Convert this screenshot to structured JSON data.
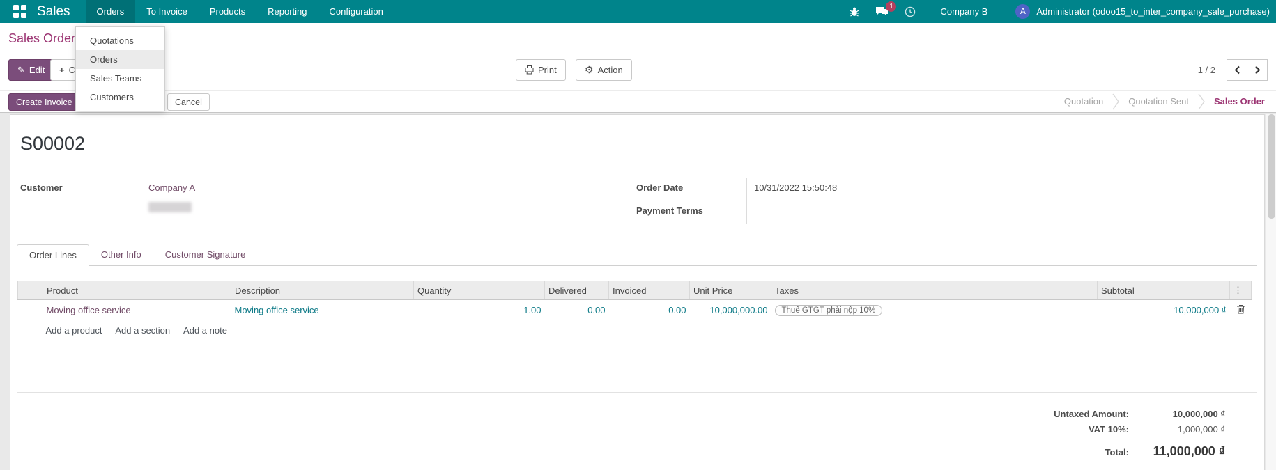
{
  "colors": {
    "topbar_teal": "#00848b",
    "brand_purple": "#7b4d7b",
    "link_purple": "#714b67",
    "active_magenta": "#9c3573",
    "value_teal": "#0d7a87",
    "badge_red": "#b33f5e",
    "avatar_blue": "#4f63c6"
  },
  "icons": {
    "apps_grid": "grid-of-squares",
    "edit_pencil": "✎",
    "create_plus": "+",
    "printer": "printer-glyph",
    "action_gear": "⚙",
    "bug": "bug-glyph",
    "messages": "chat-bubbles",
    "activities": "clock-glyph",
    "pager_prev": "chevron-left",
    "pager_next": "chevron-right",
    "delete_row": "trash-can",
    "optional_columns": "⋮"
  },
  "topbar": {
    "app_name": "Sales",
    "menu": [
      "Orders",
      "To Invoice",
      "Products",
      "Reporting",
      "Configuration"
    ],
    "active_menu": "Orders",
    "message_count": "1",
    "company": "Company B",
    "avatar_initial": "A",
    "user": "Administrator (odoo15_to_inter_company_sale_purchase)"
  },
  "breadcrumb": {
    "title": "Sales Orders"
  },
  "control_panel": {
    "edit": "Edit",
    "create": "Create",
    "print": "Print",
    "action": "Action",
    "pager": "1 / 2"
  },
  "orders_menu": {
    "items": [
      "Quotations",
      "Orders",
      "Sales Teams",
      "Customers"
    ],
    "active": "Orders"
  },
  "statusbar": {
    "create_invoice": "Create Invoice",
    "cancel": "Cancel",
    "steps": [
      "Quotation",
      "Quotation Sent",
      "Sales Order"
    ],
    "active_step": "Sales Order"
  },
  "record": {
    "name": "S00002",
    "customer_label": "Customer",
    "customer": "Company A",
    "order_date_label": "Order Date",
    "order_date": "10/31/2022 15:50:48",
    "payment_terms_label": "Payment Terms",
    "payment_terms": ""
  },
  "tabs": [
    "Order Lines",
    "Other Info",
    "Customer Signature"
  ],
  "active_tab": "Order Lines",
  "order_lines": {
    "columns": [
      "Product",
      "Description",
      "Quantity",
      "Delivered",
      "Invoiced",
      "Unit Price",
      "Taxes",
      "Subtotal"
    ],
    "rows": [
      {
        "product": "Moving office service",
        "description": "Moving office service",
        "quantity": "1.00",
        "delivered": "0.00",
        "invoiced": "0.00",
        "unit_price": "10,000,000.00",
        "taxes": "Thuế GTGT phải nộp 10%",
        "subtotal": "10,000,000 ₫"
      }
    ],
    "footer_links": [
      "Add a product",
      "Add a section",
      "Add a note"
    ]
  },
  "totals": {
    "untaxed_label": "Untaxed Amount:",
    "untaxed_value": "10,000,000 ₫",
    "vat_label": "VAT 10%:",
    "vat_value": "1,000,000 ₫",
    "total_label": "Total:",
    "total_value": "11,000,000 ₫"
  }
}
